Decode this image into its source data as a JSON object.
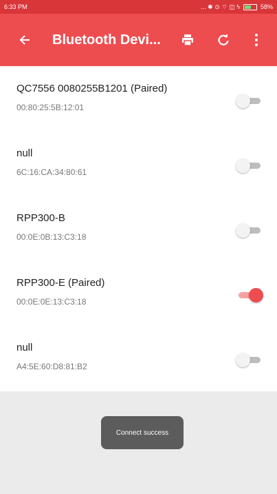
{
  "status_bar": {
    "time": "6:33 PM",
    "right_text": "... ✱ ⊙ ⌔ ◫ ϟ",
    "battery": "58%"
  },
  "app_bar": {
    "title": "Bluetooth Devi...",
    "actions": [
      "back-icon",
      "print-icon",
      "refresh-icon",
      "more-icon"
    ]
  },
  "devices": [
    {
      "name": "QC7556 0080255B1201 (Paired)",
      "address": "00:80:25:5B:12:01",
      "enabled": false
    },
    {
      "name": "null",
      "address": "6C:16:CA:34:80:61",
      "enabled": false
    },
    {
      "name": "RPP300-B",
      "address": "00:0E:0B:13:C3:18",
      "enabled": false
    },
    {
      "name": "RPP300-E (Paired)",
      "address": "00:0E:0E:13:C3:18",
      "enabled": true
    },
    {
      "name": "null",
      "address": "A4:5E:60:D8:81:B2",
      "enabled": false
    }
  ],
  "toast": {
    "message": "Connect success"
  },
  "colors": {
    "accent": "#ee4d50",
    "statusbar": "#d9363a"
  }
}
